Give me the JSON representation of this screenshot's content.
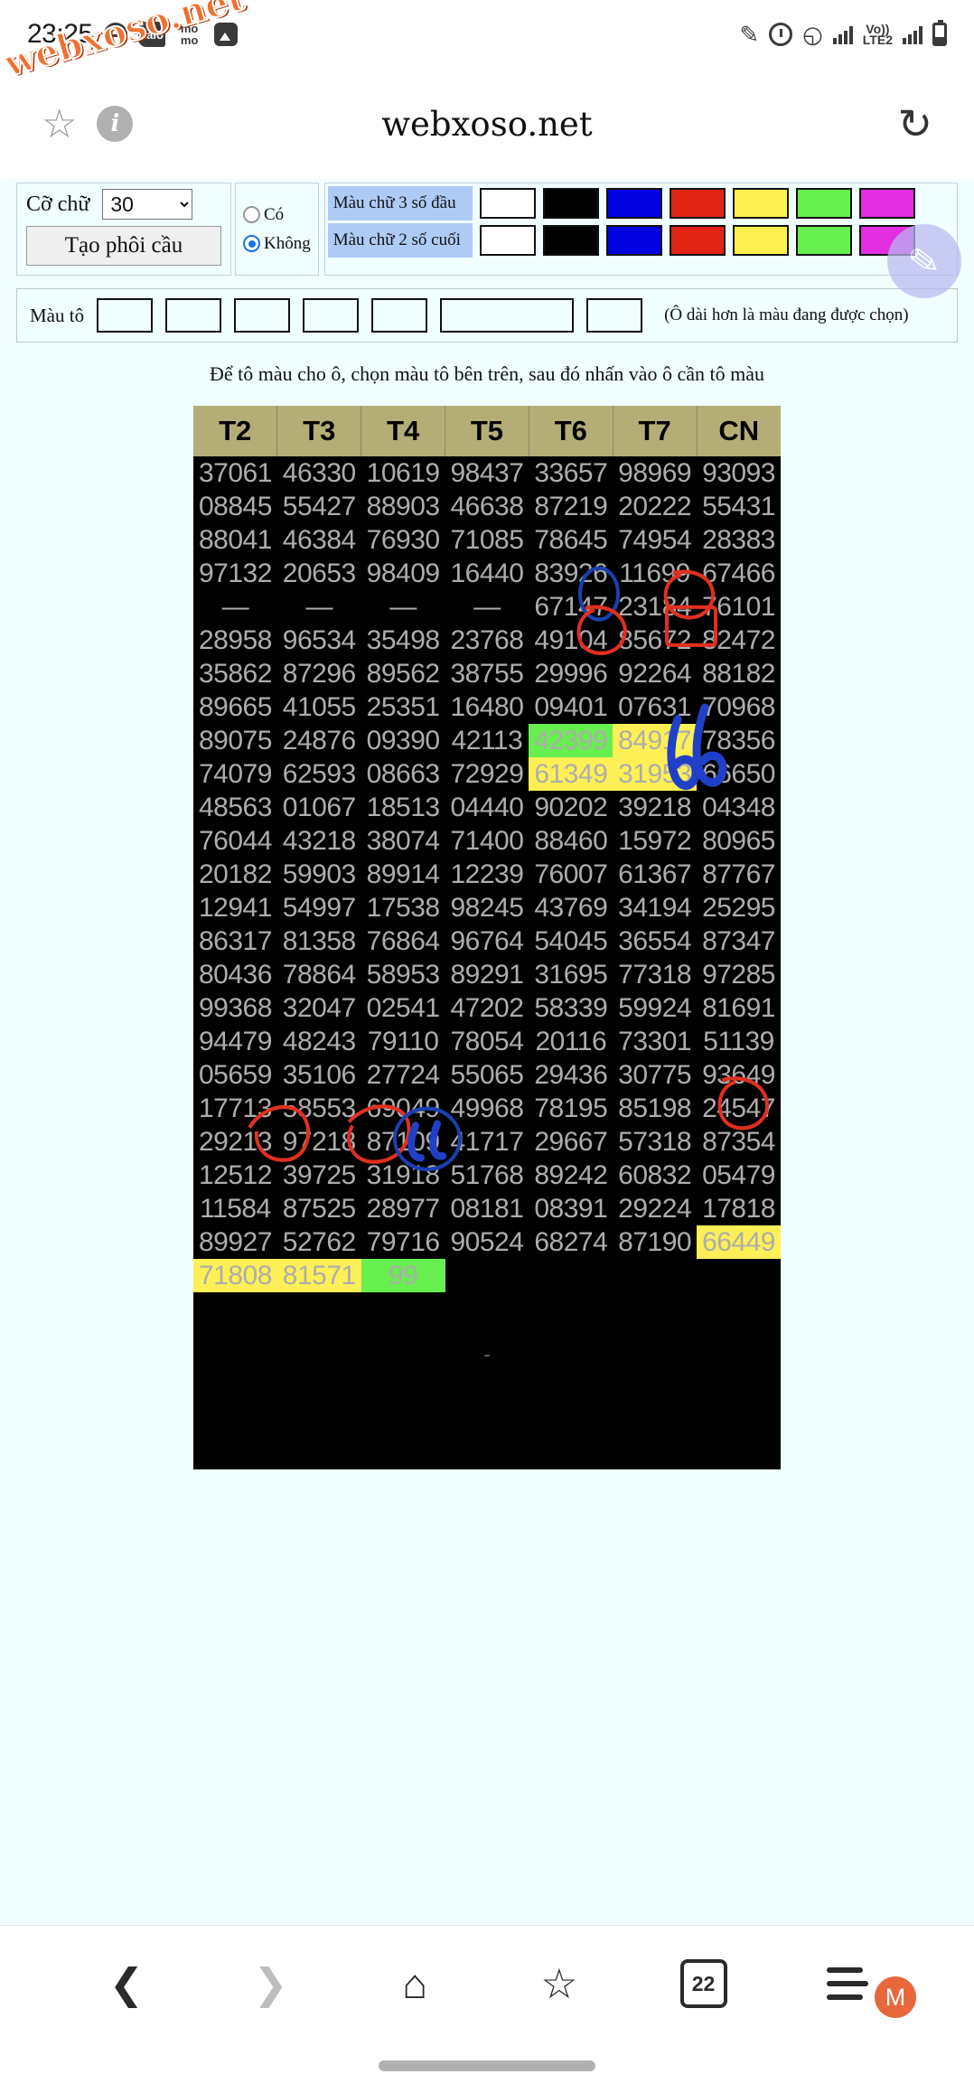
{
  "status_bar": {
    "time": "23:25",
    "left_icons": [
      "minus-circle-icon",
      "zalo-icon",
      "momo-icon",
      "photo-icon"
    ],
    "zalo_label": "Zalo",
    "momo_label_top": "mo",
    "momo_label_bottom": "mo",
    "right_icons": [
      "pen-icon",
      "alarm-icon",
      "wifi-icon",
      "signal-icon",
      "volte-icon",
      "signal2-icon",
      "battery-icon"
    ],
    "network_label": "Vo))",
    "network_label2": "LTE2"
  },
  "watermark": "webxoso.net",
  "browser": {
    "title": "webxoso.net",
    "star_icon": "☆",
    "info_icon": "i",
    "reload_icon": "↻"
  },
  "controls": {
    "font_size_label": "Cỡ chữ",
    "font_size_value": "30",
    "font_size_options": [
      "30"
    ],
    "create_button": "Tạo phôi cầu",
    "radio_yes": "Có",
    "radio_no": "Không",
    "radio_selected": "Không",
    "color_row1_label": "Màu chữ 3 số đầu",
    "color_row2_label": "Màu chữ 2 số cuối",
    "swatches": [
      "#ffffff",
      "#000000",
      "#0000e0",
      "#e02314",
      "#fcf050",
      "#66ef4e",
      "#e22fe2"
    ]
  },
  "fill": {
    "label": "Màu tô",
    "swatches": [
      "#ffffff",
      "#000000",
      "#0000e0",
      "#e02314",
      "#fcf050",
      "#66ef4e",
      "#e22fe2"
    ],
    "selected_index": 5,
    "note": "(Ô dài hơn là màu đang được chọn)"
  },
  "hint": "Để tô màu cho ô, chọn màu tô bên trên, sau đó nhấn vào ô cần tô màu",
  "table": {
    "headers": [
      "T2",
      "T3",
      "T4",
      "T5",
      "T6",
      "T7",
      "CN"
    ],
    "rows": [
      [
        "37061",
        "46330",
        "10619",
        "98437",
        "33657",
        "98969",
        "93093"
      ],
      [
        "08845",
        "55427",
        "88903",
        "46638",
        "87219",
        "20222",
        "55431"
      ],
      [
        "88041",
        "46384",
        "76930",
        "71085",
        "78645",
        "74954",
        "28383"
      ],
      [
        "97132",
        "20653",
        "98409",
        "16440",
        "83926",
        "11699",
        "67466"
      ],
      [
        "—",
        "—",
        "—",
        "—",
        "67147",
        "23184",
        "76101"
      ],
      [
        "28958",
        "96534",
        "35498",
        "23768",
        "49104",
        "85672",
        "82472"
      ],
      [
        "35862",
        "87296",
        "89562",
        "38755",
        "29996",
        "92264",
        "88182"
      ],
      [
        "89665",
        "41055",
        "25351",
        "16480",
        "09401",
        "07631",
        "70968"
      ],
      [
        "89075",
        "24876",
        "09390",
        "42113",
        "42399",
        "84917",
        "78356"
      ],
      [
        "74079",
        "62593",
        "08663",
        "72929",
        "61349",
        "31953",
        "66650"
      ],
      [
        "48563",
        "01067",
        "18513",
        "04440",
        "90202",
        "39218",
        "04348"
      ],
      [
        "76044",
        "43218",
        "38074",
        "71400",
        "88460",
        "15972",
        "80965"
      ],
      [
        "20182",
        "59903",
        "89914",
        "12239",
        "76007",
        "61367",
        "87767"
      ],
      [
        "12941",
        "54997",
        "17538",
        "98245",
        "43769",
        "34194",
        "25295"
      ],
      [
        "86317",
        "81358",
        "76864",
        "96764",
        "54045",
        "36554",
        "87347"
      ],
      [
        "80436",
        "78864",
        "58953",
        "89291",
        "31695",
        "77318",
        "97285"
      ],
      [
        "99368",
        "32047",
        "02541",
        "47202",
        "58339",
        "59924",
        "81691"
      ],
      [
        "94479",
        "48243",
        "79110",
        "78054",
        "20116",
        "73301",
        "51139"
      ],
      [
        "05659",
        "35106",
        "27724",
        "55065",
        "29436",
        "30775",
        "93649"
      ],
      [
        "17713",
        "58553",
        "69049",
        "49968",
        "78195",
        "85198",
        "24547"
      ],
      [
        "29213",
        "97218",
        "87109",
        "41717",
        "29667",
        "57318",
        "87354"
      ],
      [
        "12512",
        "39725",
        "31918",
        "51768",
        "89242",
        "60832",
        "05479"
      ],
      [
        "11584",
        "87525",
        "28977",
        "08181",
        "08391",
        "29224",
        "17818"
      ],
      [
        "89927",
        "52762",
        "79716",
        "90524",
        "68274",
        "87190",
        "66449"
      ],
      [
        "71808",
        "81571",
        "99",
        "",
        "",
        "",
        ""
      ]
    ],
    "highlights": [
      {
        "row": 8,
        "col": 4,
        "color": "green"
      },
      {
        "row": 8,
        "col": 5,
        "color": "yellow"
      },
      {
        "row": 9,
        "col": 4,
        "color": "yellow"
      },
      {
        "row": 9,
        "col": 5,
        "color": "yellow"
      },
      {
        "row": 23,
        "col": 6,
        "color": "yellow"
      },
      {
        "row": 24,
        "col": 0,
        "color": "yellow"
      },
      {
        "row": 24,
        "col": 1,
        "color": "yellow"
      },
      {
        "row": 24,
        "col": 2,
        "color": "green"
      }
    ],
    "annotations": [
      {
        "shape": "circle-blue",
        "target": "99 in row 9 col T6"
      },
      {
        "shape": "circle-red",
        "target": "17 in row 9 col T7"
      },
      {
        "shape": "circle-red",
        "target": "49 in row 10 col T6"
      },
      {
        "shape": "rect-red",
        "target": "53 in row 10 col T7"
      },
      {
        "shape": "handwriting-blue",
        "text": "66"
      },
      {
        "shape": "circle-red",
        "target": "49 in 66449"
      },
      {
        "shape": "circle-red",
        "target": "08 in 71808"
      },
      {
        "shape": "circle-red",
        "target": "71 in 81571"
      },
      {
        "shape": "circle-blue",
        "target": "99"
      }
    ],
    "tail_mark": "-"
  },
  "bottom_nav": {
    "items": [
      {
        "name": "back",
        "icon": "❮"
      },
      {
        "name": "forward",
        "icon": "❯"
      },
      {
        "name": "home",
        "icon": "⌂"
      },
      {
        "name": "bookmarks",
        "icon": "☆"
      },
      {
        "name": "tabs",
        "icon": "22"
      },
      {
        "name": "menu",
        "icon": "≡"
      }
    ],
    "tab_count": "22",
    "profile_initial": "M"
  }
}
